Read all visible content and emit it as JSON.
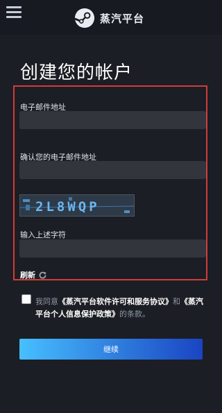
{
  "header": {
    "menu_icon": "hamburger-icon",
    "logo_icon": "steam-logo-icon",
    "brand": "蒸汽平台"
  },
  "page": {
    "title": "创建您的帐户"
  },
  "form": {
    "email_label": "电子邮件地址",
    "email_value": "",
    "confirm_label": "确认您的电子邮件地址",
    "confirm_value": "",
    "captcha_text": "2L8WQP",
    "captcha_input_label": "输入上述字符",
    "captcha_input_value": "",
    "refresh_label": "刷新",
    "refresh_icon": "refresh-icon",
    "highlight_color": "#d33b3b"
  },
  "agreement": {
    "checked": false,
    "prefix": "我同意",
    "license_link": "《蒸汽平台软件许可和服务协议》",
    "and": "和",
    "privacy_link": "《蒸汽平台个人信息保护政策》",
    "suffix": "的条款。"
  },
  "actions": {
    "continue_label": "继续"
  }
}
